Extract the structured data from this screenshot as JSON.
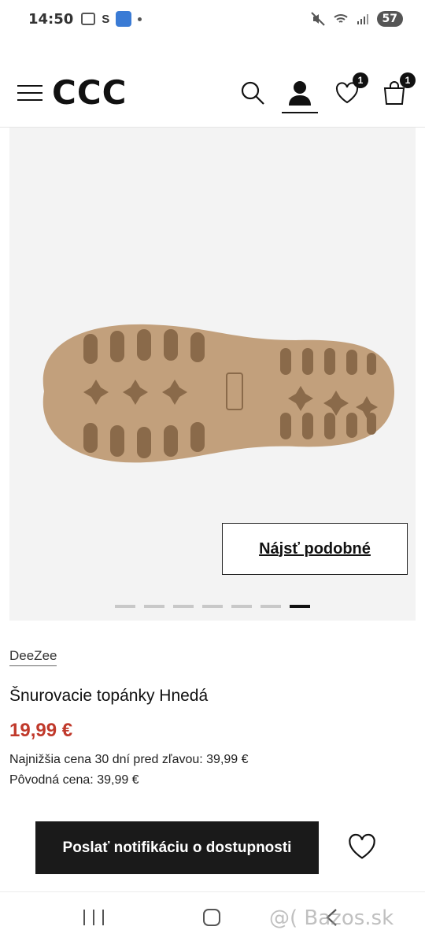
{
  "status_bar": {
    "time": "14:50",
    "s_label": "S",
    "battery": "57",
    "icons": [
      "screenshot-icon",
      "s-icon",
      "app-icon",
      "dot-icon",
      "mute-icon",
      "wifi-icon",
      "signal-icon",
      "battery-icon"
    ]
  },
  "header": {
    "logo": "CCC",
    "wishlist_count": "1",
    "cart_count": "1",
    "icons": [
      "menu-icon",
      "search-icon",
      "user-icon",
      "heart-icon",
      "bag-icon"
    ]
  },
  "gallery": {
    "find_similar_label": "Nájsť podobné",
    "image_count": 7,
    "active_index": 6,
    "sole_colors": {
      "fill": "#c2a07c",
      "shadow": "#8a6a4a"
    }
  },
  "product": {
    "brand": "DeeZee",
    "title": "Šnurovacie topánky Hnedá",
    "price": "19,99 €",
    "lowest_price_line": "Najnižšia cena 30 dní pred zľavou: 39,99 €",
    "original_price_line": "Pôvodná cena: 39,99 €"
  },
  "actions": {
    "notify_label": "Poslať notifikáciu o dostupnosti"
  },
  "nav_bar": {
    "watermark": "@( Bazos.sk"
  },
  "colors": {
    "price": "#c0392b",
    "button_bg": "#1a1a1a",
    "gallery_bg": "#f3f3f3"
  }
}
